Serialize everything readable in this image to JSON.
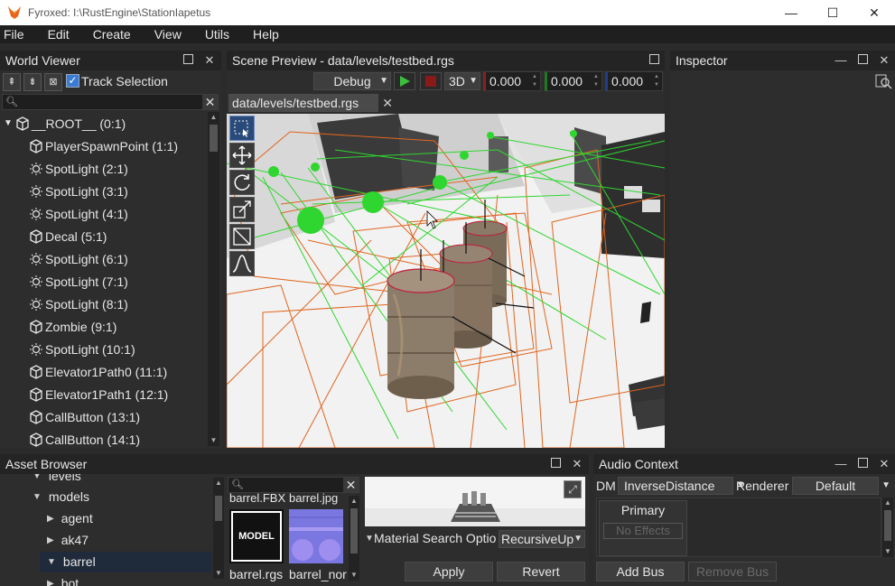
{
  "window": {
    "title": "Fyroxed: I:\\RustEngine\\StationIapetus",
    "minimize": "—",
    "maximize": "☐",
    "close": "✕"
  },
  "menu": [
    "File",
    "Edit",
    "Create",
    "View",
    "Utils",
    "Help"
  ],
  "world_viewer": {
    "title": "World Viewer",
    "track_selection_label": "Track Selection",
    "track_selection_checked": true,
    "search_placeholder": "",
    "items": [
      {
        "label": "__ROOT__ (0:1)",
        "icon": "cube-icon",
        "expander": "▼"
      },
      {
        "label": "PlayerSpawnPoint (1:1)",
        "icon": "cube-icon"
      },
      {
        "label": "SpotLight (2:1)",
        "icon": "light-icon"
      },
      {
        "label": "SpotLight (3:1)",
        "icon": "light-icon"
      },
      {
        "label": "SpotLight (4:1)",
        "icon": "light-icon"
      },
      {
        "label": "Decal (5:1)",
        "icon": "cube-icon"
      },
      {
        "label": "SpotLight (6:1)",
        "icon": "light-icon"
      },
      {
        "label": "SpotLight (7:1)",
        "icon": "light-icon"
      },
      {
        "label": "SpotLight (8:1)",
        "icon": "light-icon"
      },
      {
        "label": "Zombie (9:1)",
        "icon": "cube-icon"
      },
      {
        "label": "SpotLight (10:1)",
        "icon": "light-icon"
      },
      {
        "label": "Elevator1Path0 (11:1)",
        "icon": "cube-icon"
      },
      {
        "label": "Elevator1Path1 (12:1)",
        "icon": "cube-icon"
      },
      {
        "label": "CallButton (13:1)",
        "icon": "cube-icon"
      },
      {
        "label": "CallButton (14:1)",
        "icon": "cube-icon"
      }
    ]
  },
  "scene_preview": {
    "title": "Scene Preview - data/levels/testbed.rgs",
    "mode": "Debug",
    "view_mode": "3D",
    "x": "0.000",
    "y": "0.000",
    "z": "0.000",
    "tab_label": "data/levels/testbed.rgs"
  },
  "inspector": {
    "title": "Inspector"
  },
  "asset_browser": {
    "title": "Asset Browser",
    "folders": [
      {
        "label": "levels",
        "expander": "▼"
      },
      {
        "label": "models",
        "expander": "▼"
      },
      {
        "label": "agent",
        "expander": "▶"
      },
      {
        "label": "ak47",
        "expander": "▶"
      },
      {
        "label": "barrel",
        "expander": "▼"
      },
      {
        "label": "bot",
        "expander": "▶"
      }
    ],
    "files_top": [
      "barrel.FBX",
      "barrel.jpg"
    ],
    "files": [
      {
        "name": "barrel.rgs",
        "thumb": "MODEL"
      },
      {
        "name": "barrel_normal.png",
        "thumb": ""
      }
    ],
    "material_search_label": "Material Search Options",
    "material_search_value": "RecursiveUp",
    "apply": "Apply",
    "revert": "Revert"
  },
  "audio_context": {
    "title": "Audio Context",
    "dm_label": "DM",
    "dm_value": "InverseDistance",
    "renderer_label": "Renderer",
    "renderer_value": "Default",
    "bus_name": "Primary",
    "effects": "No Effects",
    "add_bus": "Add Bus",
    "remove_bus": "Remove Bus"
  },
  "colors": {
    "accent_selection": "#1f2a3a",
    "play_green": "#3cbf3c",
    "stop_red": "#8a1a1a",
    "wire_orange": "#e0651f",
    "wire_green": "#2fd62f"
  }
}
